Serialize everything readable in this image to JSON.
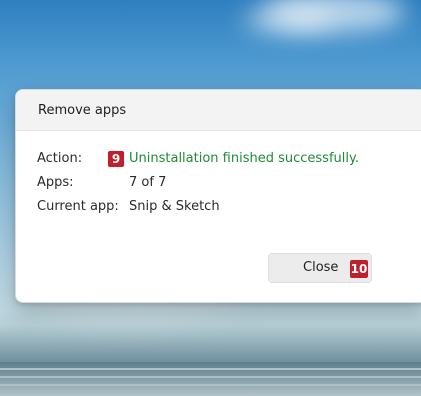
{
  "dialog": {
    "title": "Remove apps",
    "rows": [
      {
        "label": "Action:",
        "value": "Uninstallation finished successfully.",
        "badge": "9",
        "status_color": "#1f8a38"
      },
      {
        "label": "Apps:",
        "value": "7 of 7"
      },
      {
        "label": "Current app:",
        "value": "Snip & Sketch"
      }
    ],
    "close_button": {
      "label": "Close",
      "badge": "10"
    }
  },
  "colors": {
    "badge": "#c11f2b",
    "success": "#1f8a38"
  }
}
